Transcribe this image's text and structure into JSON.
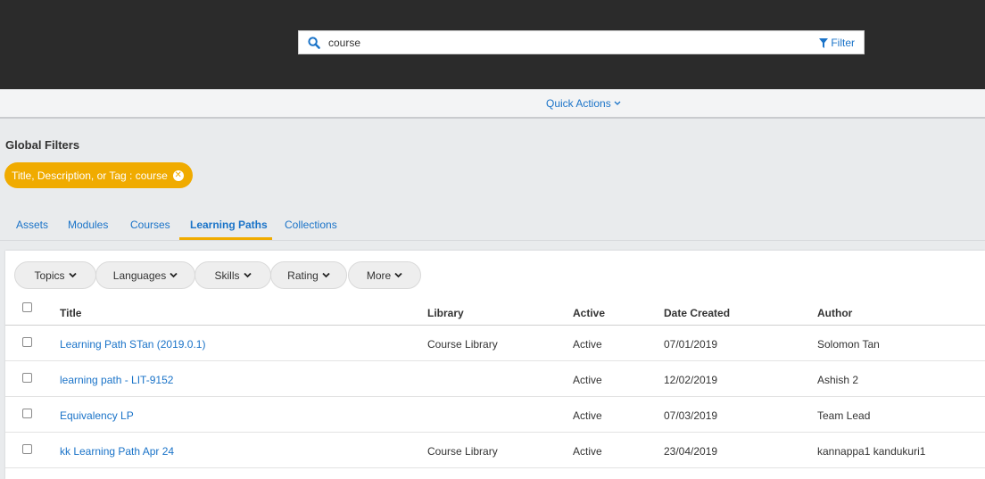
{
  "search": {
    "value": "course",
    "filter_label": "Filter"
  },
  "quick_actions": {
    "label": "Quick Actions"
  },
  "global_filters": {
    "title": "Global Filters",
    "chip_label": "Title, Description, or Tag : course"
  },
  "tabs": [
    {
      "label": "Assets",
      "active": false
    },
    {
      "label": "Modules",
      "active": false
    },
    {
      "label": "Courses",
      "active": false
    },
    {
      "label": "Learning Paths",
      "active": true
    },
    {
      "label": "Collections",
      "active": false
    }
  ],
  "facets": [
    {
      "label": "Topics"
    },
    {
      "label": "Languages"
    },
    {
      "label": "Skills"
    },
    {
      "label": "Rating"
    },
    {
      "label": "More"
    }
  ],
  "table": {
    "headers": {
      "title": "Title",
      "library": "Library",
      "active": "Active",
      "date_created": "Date Created",
      "author": "Author"
    },
    "rows": [
      {
        "title": "Learning Path STan (2019.0.1)",
        "library": "Course Library",
        "active": "Active",
        "date": "07/01/2019",
        "author": "Solomon Tan"
      },
      {
        "title": "learning path - LIT-9152",
        "library": "",
        "active": "Active",
        "date": "12/02/2019",
        "author": "Ashish 2"
      },
      {
        "title": "Equivalency LP",
        "library": "",
        "active": "Active",
        "date": "07/03/2019",
        "author": "Team Lead"
      },
      {
        "title": "kk Learning Path Apr 24",
        "library": "Course Library",
        "active": "Active",
        "date": "23/04/2019",
        "author": "kannappa1 kandukuri1"
      }
    ]
  },
  "colors": {
    "accent": "#f0ab00",
    "link": "#1a73c8",
    "topbar": "#2b2b2b"
  }
}
